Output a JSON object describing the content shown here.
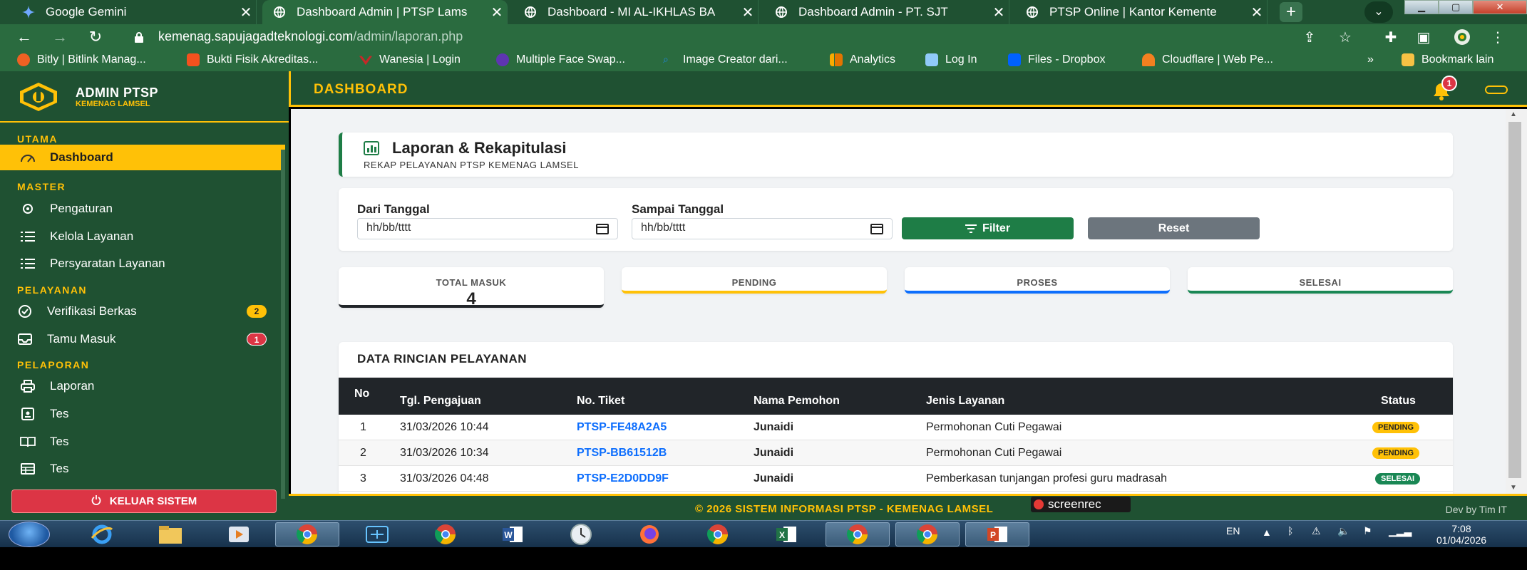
{
  "browser": {
    "tabs": [
      {
        "title": "Google Gemini",
        "active": false
      },
      {
        "title": "Dashboard Admin | PTSP Lams",
        "active": true
      },
      {
        "title": "Dashboard - MI AL-IKHLAS BA",
        "active": false
      },
      {
        "title": "Dashboard Admin - PT. SJT",
        "active": false
      },
      {
        "title": "PTSP Online | Kantor Kemente",
        "active": false
      }
    ],
    "new_tab": "+",
    "url_host": "kemenag.sapujagadteknologi.com",
    "url_path": "/admin/laporan.php",
    "bookmarks": [
      {
        "label": "Bitly | Bitlink Manag...",
        "color": "#ee6123"
      },
      {
        "label": "Bukti Fisik Akreditas...",
        "color": "#f4511e"
      },
      {
        "label": "Wanesia | Login",
        "color": "#c62828"
      },
      {
        "label": "Multiple Face Swap...",
        "color": "#5e35b1"
      },
      {
        "label": "Image Creator dari...",
        "color": "#1e88e5"
      },
      {
        "label": "Analytics",
        "color": "#f9ab00"
      },
      {
        "label": "Log In",
        "color": "#90caf9"
      },
      {
        "label": "Files - Dropbox",
        "color": "#0061fe"
      },
      {
        "label": "Cloudflare | Web Pe...",
        "color": "#f38020"
      }
    ],
    "bookmark_more": "»",
    "bookmark_other": "Bookmark lain"
  },
  "sidebar": {
    "brand_title": "ADMIN PTSP",
    "brand_sub": "KEMENAG LAMSEL",
    "sections": {
      "utama": "UTAMA",
      "master": "MASTER",
      "pelayanan": "PELAYANAN",
      "pelaporan": "PELAPORAN"
    },
    "items": {
      "dashboard": "Dashboard",
      "pengaturan": "Pengaturan",
      "kelola": "Kelola Layanan",
      "persyaratan": "Persyaratan Layanan",
      "verifikasi": "Verifikasi Berkas",
      "verifikasi_badge": "2",
      "tamu": "Tamu Masuk",
      "tamu_badge": "1",
      "laporan": "Laporan",
      "tes1": "Tes",
      "tes2": "Tes",
      "tes3": "Tes"
    },
    "logout": "KELUAR SISTEM"
  },
  "topbar": {
    "title": "DASHBOARD",
    "notif_count": "1"
  },
  "page": {
    "heading": "Laporan & Rekapitulasi",
    "subheading": "REKAP PELAYANAN PTSP KEMENAG LAMSEL",
    "filter": {
      "from_label": "Dari Tanggal",
      "from_placeholder": "hh/bb/tttt",
      "to_label": "Sampai Tanggal",
      "to_placeholder": "hh/bb/tttt",
      "filter_button": "Filter",
      "reset_button": "Reset"
    },
    "stats": [
      {
        "label": "TOTAL MASUK",
        "value": "4",
        "color": "#212529"
      },
      {
        "label": "PENDING",
        "value": "",
        "color": "#ffc107"
      },
      {
        "label": "PROSES",
        "value": "",
        "color": "#0d6efd"
      },
      {
        "label": "SELESAI",
        "value": "",
        "color": "#198754"
      }
    ],
    "table": {
      "title": "DATA RINCIAN PELAYANAN",
      "columns": [
        "No",
        "Tgl. Pengajuan",
        "No. Tiket",
        "Nama Pemohon",
        "Jenis Layanan",
        "Status"
      ],
      "rows": [
        {
          "no": "1",
          "tgl": "31/03/2026 10:44",
          "tiket": "PTSP-FE48A2A5",
          "nama": "Junaidi",
          "jenis": "Permohonan Cuti Pegawai",
          "status": "PENDING"
        },
        {
          "no": "2",
          "tgl": "31/03/2026 10:34",
          "tiket": "PTSP-BB61512B",
          "nama": "Junaidi",
          "jenis": "Permohonan Cuti Pegawai",
          "status": "PENDING"
        },
        {
          "no": "3",
          "tgl": "31/03/2026 04:48",
          "tiket": "PTSP-E2D0DD9F",
          "nama": "Junaidi",
          "jenis": "Pemberkasan tunjangan profesi guru madrasah",
          "status": "SELESAI"
        }
      ]
    }
  },
  "footer": {
    "copyright": "© 2026 SISTEM INFORMASI PTSP - KEMENAG LAMSEL",
    "dev": "Dev by Tim IT",
    "watermark": "screenrec"
  },
  "taskbar": {
    "lang": "EN",
    "time": "7:08",
    "date": "01/04/2026"
  }
}
